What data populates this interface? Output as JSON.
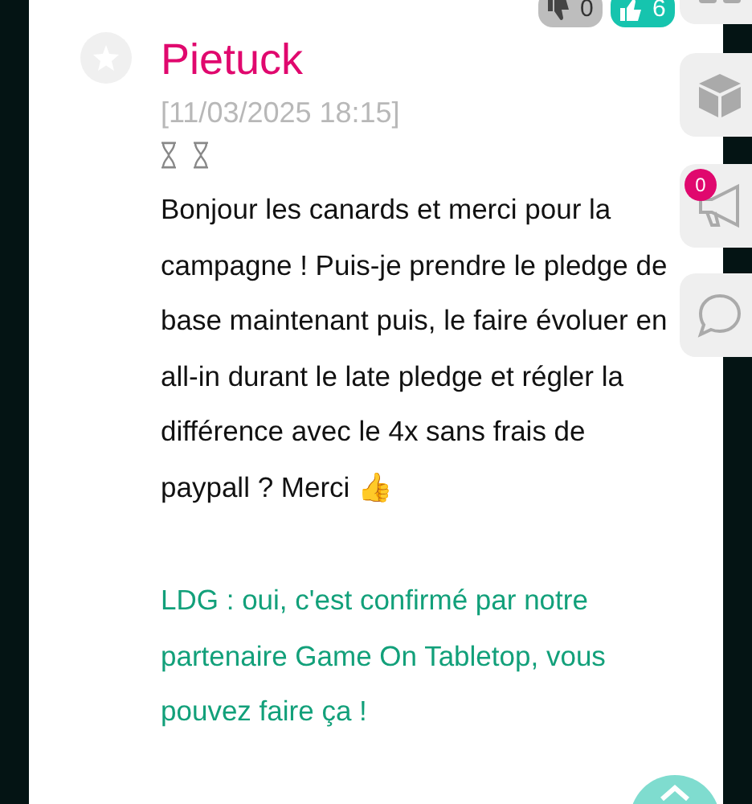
{
  "votes": {
    "dislikes": "0",
    "likes": "6"
  },
  "post": {
    "author": "Pietuck",
    "date": "[11/03/2025 18:15]",
    "body": "Bonjour les canards et merci pour la campagne ! Puis-je prendre le pledge de base maintenant puis, le faire évoluer en all-in durant le late pledge et régler la différence avec le 4x sans frais de paypall ? Merci 👍",
    "answer": "LDG : oui, c'est confirmé par notre partenaire Game On Tabletop, vous pouvez faire ça !"
  },
  "side_menu": [
    {
      "kind": "grid"
    },
    {
      "kind": "box"
    },
    {
      "kind": "megaphone",
      "badge": "0"
    },
    {
      "kind": "chat"
    }
  ]
}
